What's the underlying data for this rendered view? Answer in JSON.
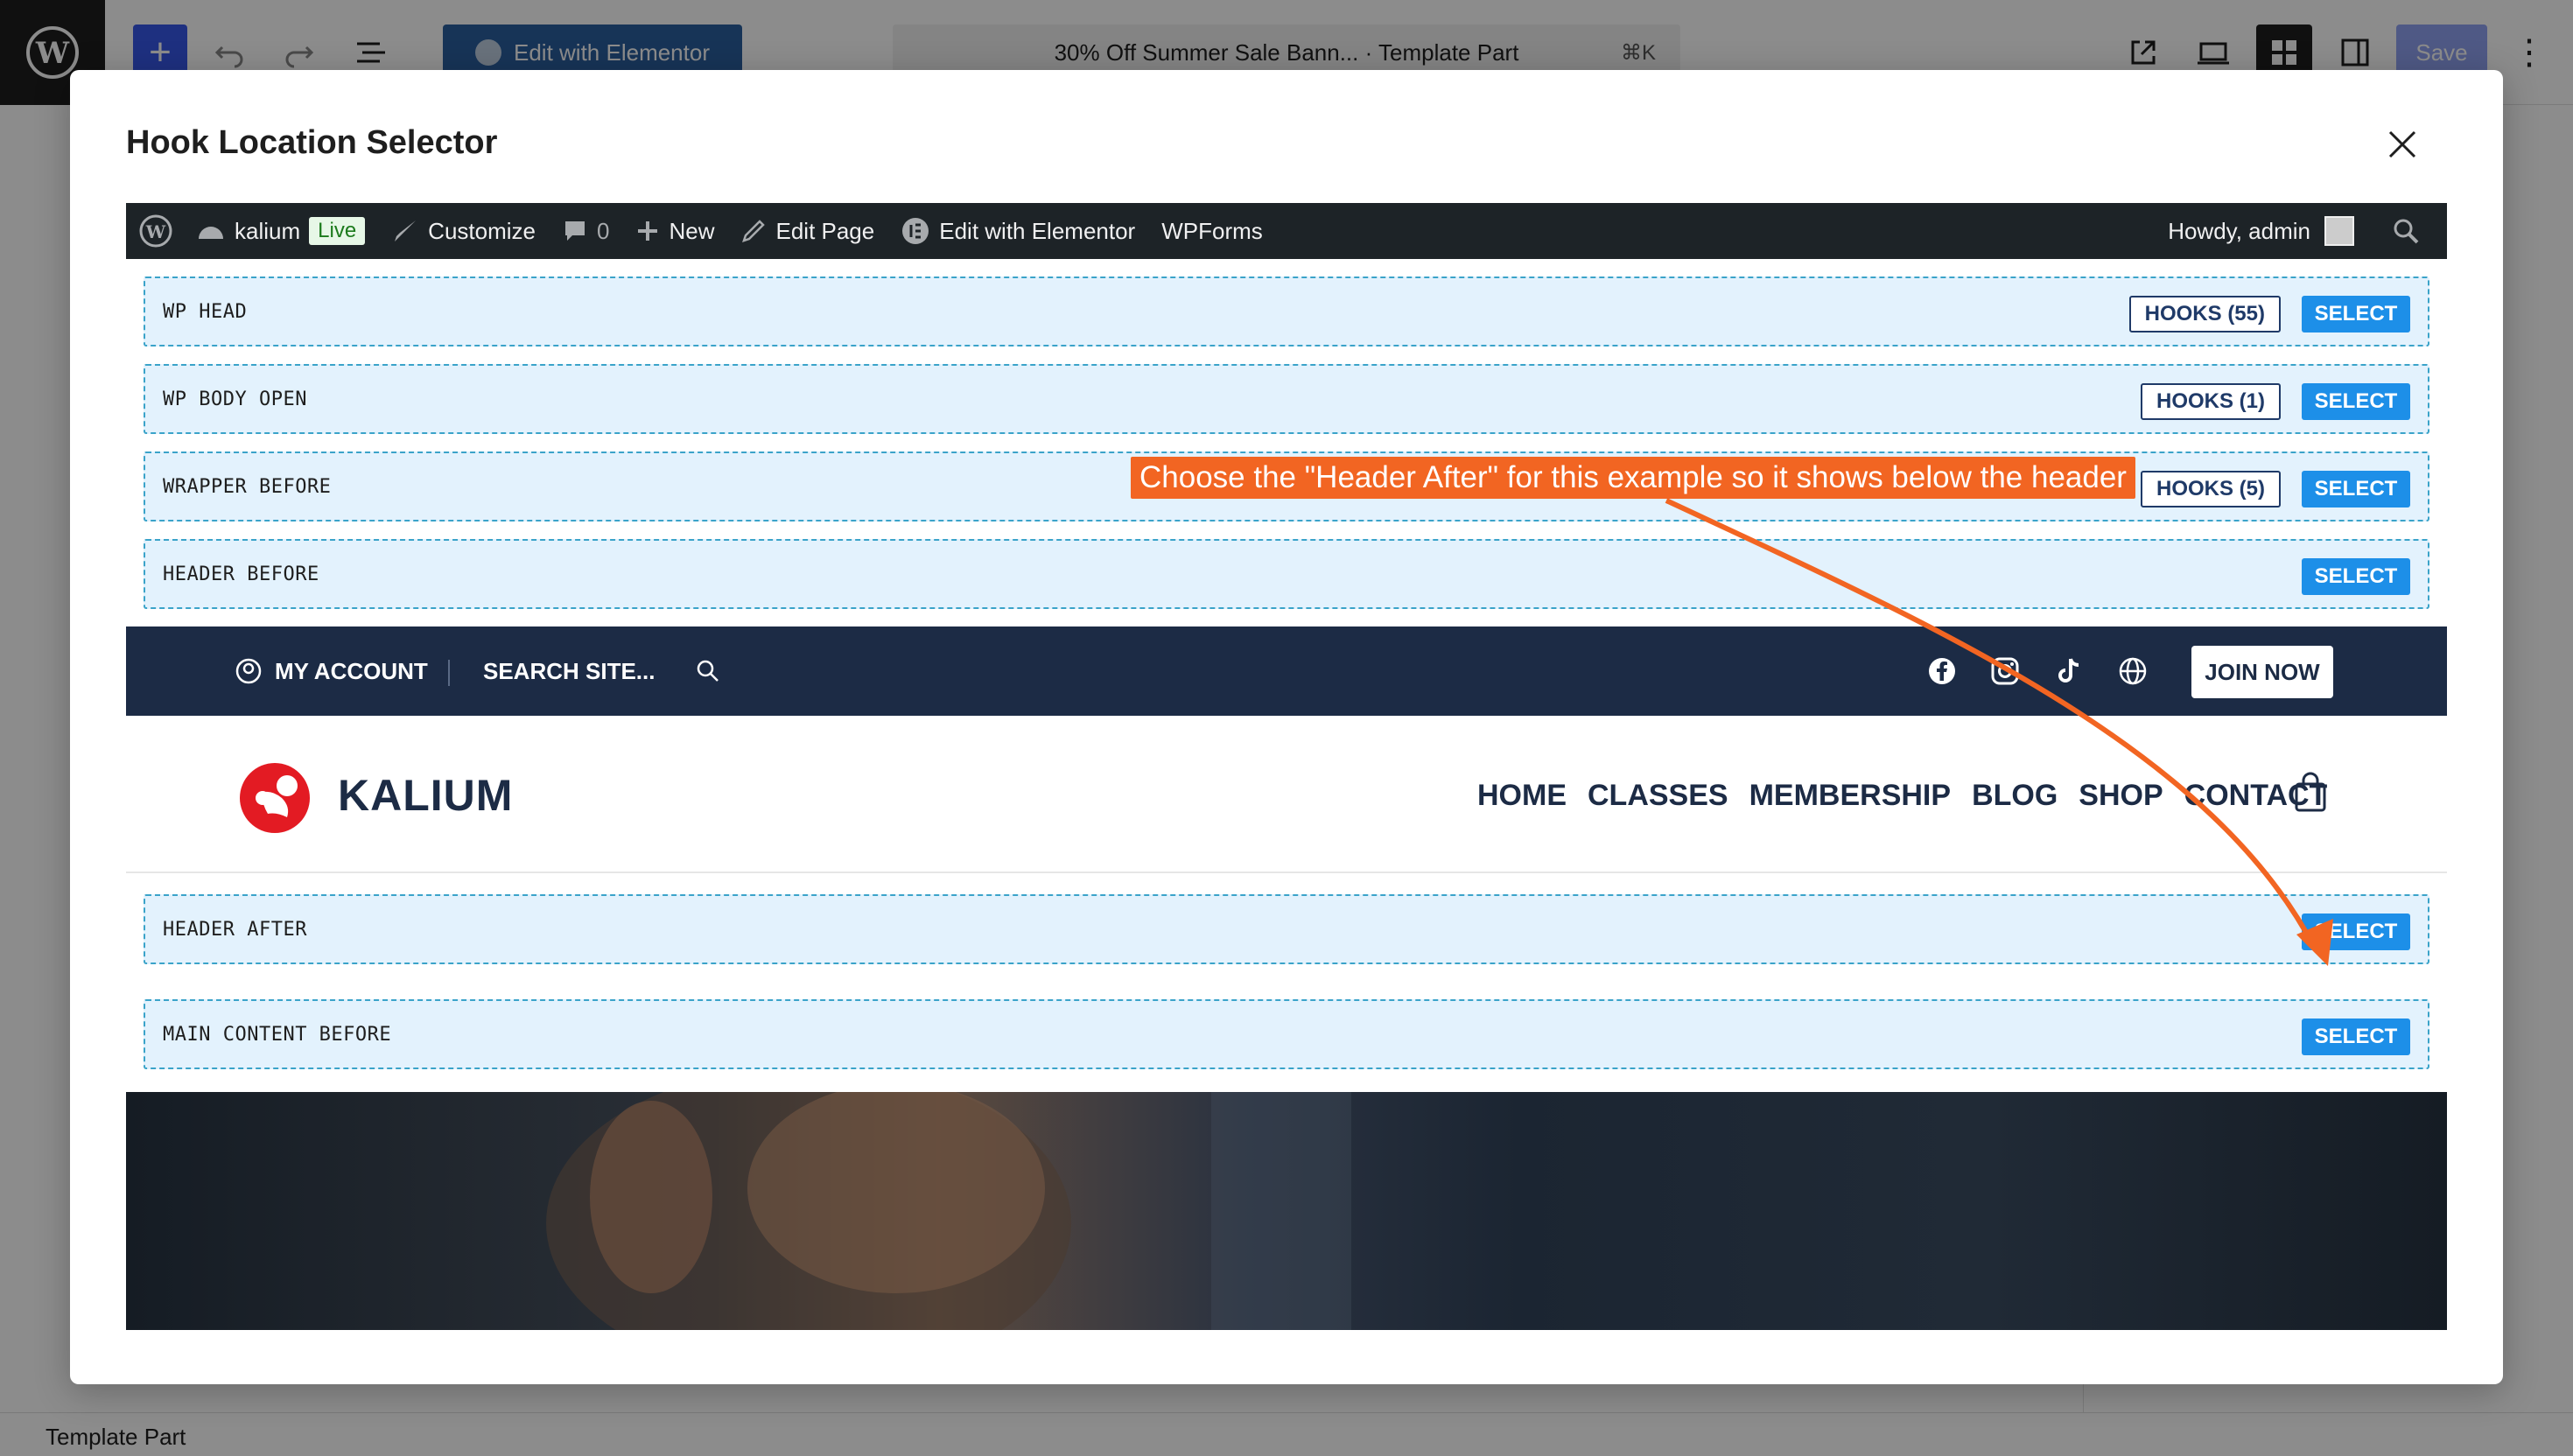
{
  "editor": {
    "command_title": "30% Off Summer Sale Bann... · Template Part",
    "command_shortcut": "⌘K",
    "elementor_label": "Edit with Elementor",
    "save_label": "Save",
    "footer_label": "Template Part"
  },
  "modal": {
    "title": "Hook Location Selector"
  },
  "adminbar": {
    "site_name": "kalium",
    "live_badge": "Live",
    "customize": "Customize",
    "comments_count": "0",
    "new": "New",
    "edit_page": "Edit Page",
    "edit_elementor": "Edit with Elementor",
    "wpforms": "WPForms",
    "howdy": "Howdy, admin"
  },
  "hooks": {
    "wp_head": {
      "label": "WP HEAD",
      "count": "HOOKS (55)",
      "select": "SELECT"
    },
    "wp_body_open": {
      "label": "WP BODY OPEN",
      "count": "HOOKS (1)",
      "select": "SELECT"
    },
    "wrapper_before": {
      "label": "WRAPPER BEFORE",
      "count": "HOOKS (5)",
      "select": "SELECT"
    },
    "header_before": {
      "label": "HEADER BEFORE",
      "select": "SELECT"
    },
    "header_after": {
      "label": "HEADER AFTER",
      "select": "SELECT"
    },
    "main_content_before": {
      "label": "MAIN CONTENT BEFORE",
      "select": "SELECT"
    }
  },
  "site": {
    "my_account": "MY ACCOUNT",
    "search": "SEARCH SITE...",
    "join_now": "JOIN NOW",
    "logo_text": "KALIUM",
    "menu": [
      "HOME",
      "CLASSES",
      "MEMBERSHIP",
      "BLOG",
      "SHOP",
      "CONTACT"
    ]
  },
  "annotation": {
    "text": "Choose the \"Header After\" for this example so it shows below the header",
    "color": "#f26522"
  },
  "colors": {
    "wp_blue": "#3858e9",
    "select_blue": "#1d8fe8",
    "site_navy": "#1c2b45",
    "logo_red": "#e31b23"
  }
}
